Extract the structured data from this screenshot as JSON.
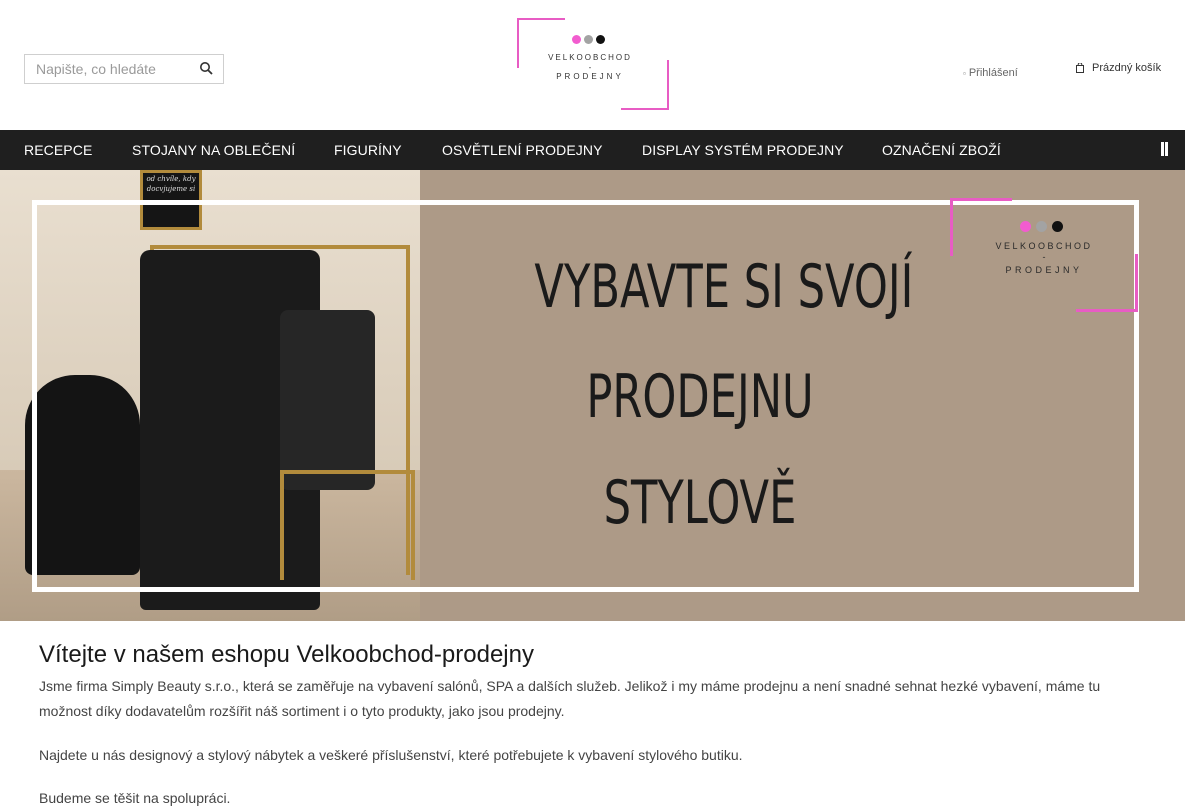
{
  "header": {
    "search_placeholder": "Napište, co hledáte",
    "logo": {
      "line1": "VELKOOBCHOD",
      "line2": "-",
      "line3": "PRODEJNY",
      "dot_colors": [
        "#f25ccf",
        "#a3a3a3",
        "#111111"
      ],
      "accent_color": "#e85cc4"
    },
    "login_label": "Přihlášení",
    "cart_label": "Prázdný košík"
  },
  "nav": {
    "items": [
      "RECEPCE",
      "STOJANY NA OBLEČENÍ",
      "FIGURÍNY",
      "OSVĚTLENÍ PRODEJNY",
      "DISPLAY SYSTÉM PRODEJNY",
      "OZNAČENÍ ZBOŽÍ"
    ],
    "more_icon": "menu-more-icon"
  },
  "banner": {
    "headline_line1": "VYBAVTE SI SVOJÍ",
    "headline_line2": "PRODEJNU",
    "headline_line3": "STYLOVĚ",
    "logo_line1": "VELKOOBCHOD",
    "logo_line2": "-",
    "logo_line3": "PRODEJNY",
    "frame_text": "od chvíle, kdy docvjujeme si"
  },
  "main": {
    "title": "Vítejte v našem eshopu Velkoobchod-prodejny",
    "paragraph1": "Jsme firma Simply Beauty s.r.o., která se zaměřuje na vybavení salónů, SPA a dalších služeb. Jelikož i my máme prodejnu a není snadné sehnat hezké vybavení, máme tu možnost díky dodavatelům rozšířit náš sortiment i o tyto produkty, jako jsou prodejny.",
    "paragraph2": "Najdete u nás designový a stylový nábytek a veškeré příslušenství, které potřebujete k vybavení stylového butiku.",
    "paragraph3": "Budeme se těšit na spolupráci."
  }
}
